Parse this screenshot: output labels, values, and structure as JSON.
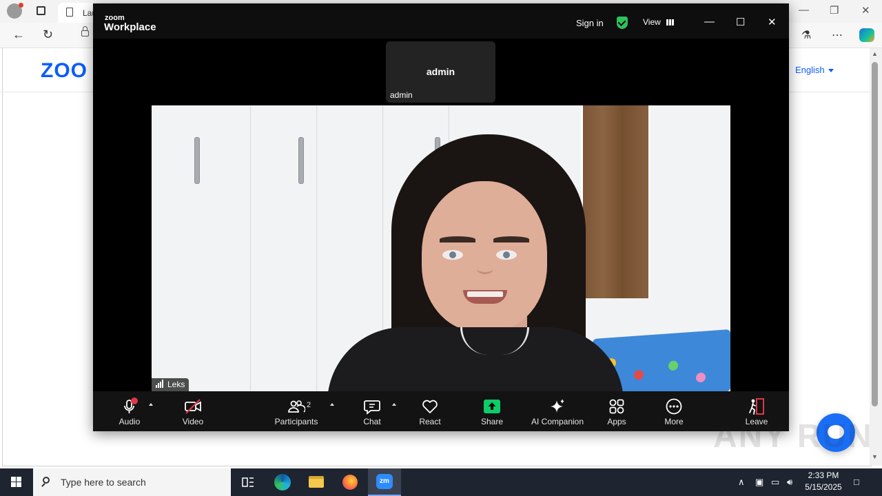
{
  "browser": {
    "tab_title": "Lau",
    "website_logo": "ZOO",
    "language_selector": "English"
  },
  "zoom": {
    "brand_small": "zoom",
    "brand_big": "Workplace",
    "sign_in": "Sign in",
    "view_label": "View",
    "tile": {
      "center_name": "admin",
      "label": "admin"
    },
    "video": {
      "name_badge": "Leks"
    },
    "controls": {
      "audio": "Audio",
      "video": "Video",
      "participants": "Participants",
      "participants_count": "2",
      "chat": "Chat",
      "react": "React",
      "share": "Share",
      "ai_companion": "AI Companion",
      "apps": "Apps",
      "more": "More",
      "leave": "Leave"
    },
    "colors": {
      "share_green": "#0ecc67",
      "secure_green": "#2fc15c",
      "leave_red": "#e0364a",
      "mute_red": "#e0364a"
    }
  },
  "taskbar": {
    "search_placeholder": "Type here to search",
    "time": "2:33 PM",
    "date": "5/15/2025",
    "apps": [
      "task-view-icon",
      "edge-icon",
      "file-explorer-icon",
      "firefox-icon",
      "zoom-icon"
    ]
  },
  "watermark": "ANY RUN"
}
